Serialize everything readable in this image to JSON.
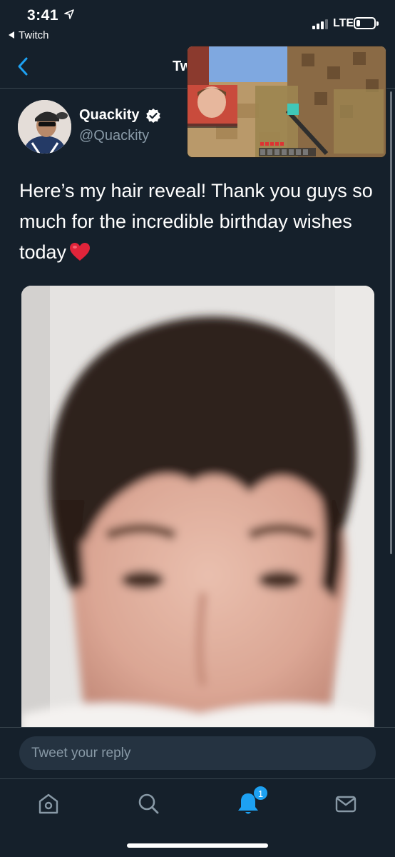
{
  "status_bar": {
    "time": "3:41",
    "back_app": "Twitch",
    "network": "LTE"
  },
  "nav": {
    "title": "Tw"
  },
  "pip_video": {
    "icon": "minecraft-stream-video"
  },
  "tweet": {
    "display_name": "Quackity",
    "handle": "@Quackity",
    "text": "Here’s my hair reveal! Thank you guys so much for the incredible birthday wishes today",
    "emoji": "red-heart-emoji"
  },
  "reply": {
    "placeholder": "Tweet your reply"
  },
  "tab_bar": {
    "items": [
      "home-icon",
      "search-icon",
      "notifications-icon",
      "messages-icon"
    ],
    "notifications_badge": "1"
  },
  "colors": {
    "background": "#15202b",
    "accent": "#1da1f2",
    "secondary_text": "#8899a6",
    "divider": "#38444d"
  }
}
